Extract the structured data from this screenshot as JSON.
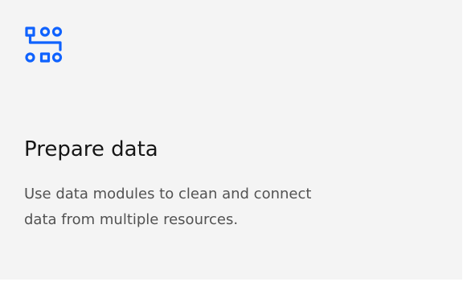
{
  "tile": {
    "icon": "data-flow-icon",
    "title": "Prepare data",
    "description": "Use data modules to clean and connect data from multiple resources.",
    "accent_color": "#0f62fe"
  }
}
